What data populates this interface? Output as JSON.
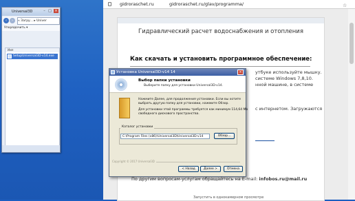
{
  "explorer": {
    "title": "Universal3D",
    "address": "« Загру... ▸ Univer",
    "menu_label": "Упорядочить ▾",
    "column_header": "Имя",
    "files": [
      {
        "name": "SetupUniversal3D-v14.exe"
      }
    ]
  },
  "browser": {
    "site": "gidroraschet.ru",
    "path": "gidroraschet.ru/glav/programma/"
  },
  "page": {
    "title": "Гидравлический расчет водоснабжения и отопления",
    "subtitle": "Как скачать и установить программное обеспечение:",
    "frag1": "утбуке используйте мышку.",
    "frag2": "системе Windows 7,8,10.",
    "frag3": "нной машине, в системе",
    "frag4": "с интернетом. Загружаются",
    "contact_prefix": "По другим вопросам-услугам обращайтесь на E-mail:",
    "contact_email": "infobos.ru@mail.ru",
    "footer": "Запустить в однокамерном просмотре"
  },
  "dialog": {
    "title": "Установка Universal3D-v14 14",
    "header_title": "Выбор папки установки",
    "header_sub": "Выберите папку для установки Universal3D-v14.",
    "text1a": "Нажмите Далее, для продолжения установки. Если вы хотите",
    "text1b": "выбрать другую папку для установки, нажмите Обзор.",
    "text2a": "Для установки этой программы требуется как минимум 114,64 Mb",
    "text2b": "свободного дискового пространства.",
    "group_label": "Каталог установки",
    "install_path": "C:\\Program Files (x86)\\Universal3D\\Universal3D-v14",
    "browse_label": "Обзор...",
    "copyright": "Copyright © 2017 Universal3D",
    "back_label": "< Назад",
    "next_label": "Далее >",
    "cancel_label": "Отмена"
  }
}
